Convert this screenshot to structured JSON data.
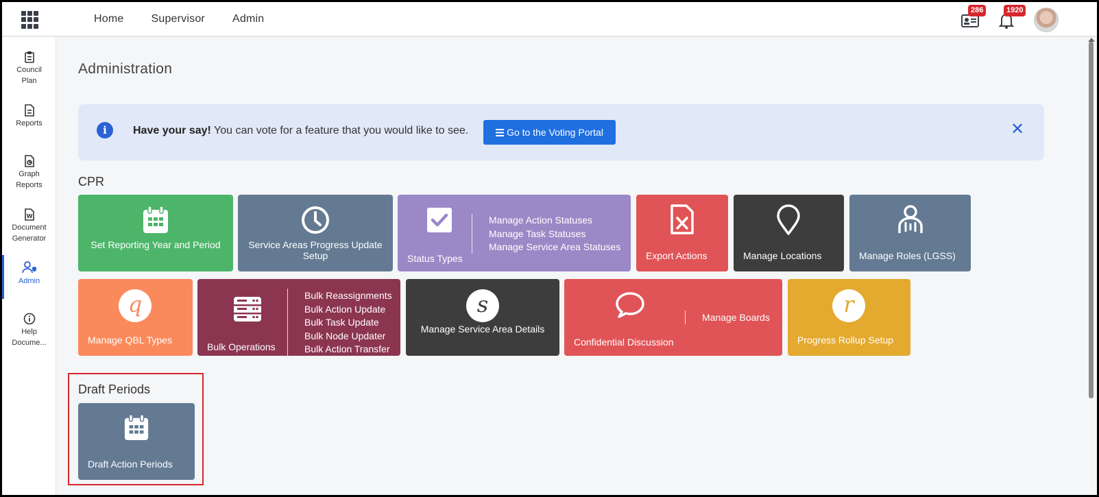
{
  "topnav": {
    "items": [
      "Home",
      "Supervisor",
      "Admin"
    ],
    "badges": {
      "messages": "286",
      "notifications": "1920"
    }
  },
  "sidebar": {
    "items": [
      {
        "label": "Council Plan",
        "icon": "clipboard-icon"
      },
      {
        "label": "Reports",
        "icon": "document-icon"
      },
      {
        "label": "Graph Reports",
        "icon": "graph-document-icon"
      },
      {
        "label": "Document Generator",
        "icon": "word-document-icon"
      },
      {
        "label": "Admin",
        "icon": "admin-user-icon",
        "active": true
      },
      {
        "label": "Help Docume...",
        "icon": "info-circle-icon"
      }
    ]
  },
  "page": {
    "title": "Administration"
  },
  "banner": {
    "bold": "Have your say!",
    "text": " You can vote for a feature that you would like to see.",
    "button": "Go to the Voting Portal"
  },
  "cpr": {
    "heading": "CPR",
    "tiles": [
      {
        "label": "Set Reporting Year and Period",
        "color": "#4db56a",
        "icon": "calendar-icon"
      },
      {
        "label": "Service Areas Progress Update Setup",
        "color": "#637a92",
        "icon": "clock-icon"
      },
      {
        "label": "Status Types",
        "color": "#9b88c6",
        "icon": "checkbox-icon",
        "subitems": [
          "Manage Action Statuses",
          "Manage Task Statuses",
          "Manage Service Area Statuses"
        ]
      },
      {
        "label": "Export Actions",
        "color": "#e05356",
        "icon": "excel-file-icon"
      },
      {
        "label": "Manage Locations",
        "color": "#3d3d3d",
        "icon": "location-pin-icon"
      },
      {
        "label": "Manage Roles (LGSS)",
        "color": "#637a92",
        "icon": "users-role-icon"
      },
      {
        "label": "Manage QBL Types",
        "color": "#fa8a5c",
        "icon": "q-letter-icon",
        "letter": "q"
      },
      {
        "label": "Bulk Operations",
        "color": "#8b3550",
        "icon": "server-stack-icon",
        "subitems": [
          "Bulk Reassignments",
          "Bulk Action Update",
          "Bulk Task Update",
          "Bulk Node Updater",
          "Bulk Action Transfer"
        ]
      },
      {
        "label": "Manage Service Area Details",
        "color": "#3d3d3d",
        "icon": "s-letter-icon",
        "letter": "s"
      },
      {
        "label": "Confidential Discussion",
        "color": "#e05356",
        "icon": "chat-bubble-icon",
        "subitems": [
          "Manage Boards"
        ]
      },
      {
        "label": "Progress Rollup Setup",
        "color": "#e4a92f",
        "icon": "r-letter-icon",
        "letter": "r"
      }
    ]
  },
  "draft": {
    "heading": "Draft Periods",
    "tiles": [
      {
        "label": "Draft Action Periods",
        "color": "#637a92",
        "icon": "calendar-icon"
      }
    ]
  }
}
